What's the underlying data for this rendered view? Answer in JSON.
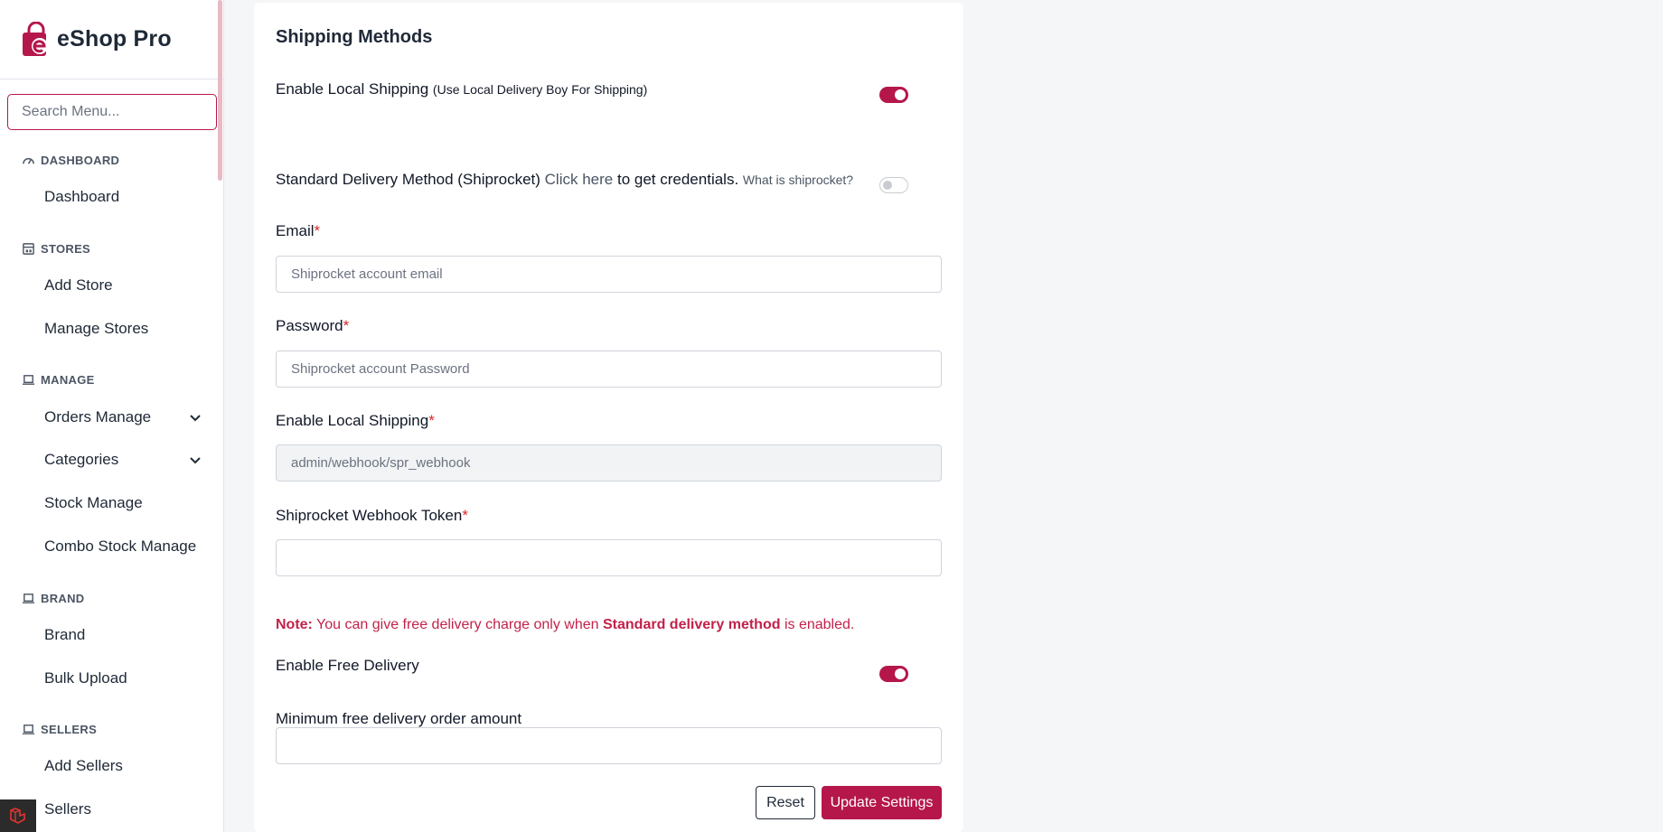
{
  "sidebar": {
    "logo_text": "eShop Pro",
    "search_placeholder": "Search Menu...",
    "sections": {
      "dashboard": {
        "title": "DASHBOARD",
        "items": [
          "Dashboard"
        ]
      },
      "stores": {
        "title": "STORES",
        "items": [
          "Add Store",
          "Manage Stores"
        ]
      },
      "manage": {
        "title": "MANAGE",
        "items": [
          "Orders Manage",
          "Categories",
          "Stock Manage",
          "Combo Stock Manage"
        ]
      },
      "brand": {
        "title": "BRAND",
        "items": [
          "Brand",
          "Bulk Upload"
        ]
      },
      "sellers": {
        "title": "SELLERS",
        "items": [
          "Add Sellers",
          "Sellers"
        ]
      }
    }
  },
  "main": {
    "title": "Shipping Methods",
    "local_shipping": {
      "label": "Enable Local Shipping",
      "hint": "(Use Local Delivery Boy For Shipping)",
      "enabled": true
    },
    "standard_delivery": {
      "label": "Standard Delivery Method (Shiprocket)",
      "link": "Click here",
      "after_link": "to get credentials.",
      "hint": "What is shiprocket?",
      "enabled": false
    },
    "email": {
      "label": "Email",
      "required_mark": "*",
      "placeholder": "Shiprocket account email"
    },
    "password": {
      "label": "Password",
      "required_mark": "*",
      "placeholder": "Shiprocket account Password"
    },
    "webhook_url": {
      "label": "Enable Local Shipping",
      "required_mark": "*",
      "value": "admin/webhook/spr_webhook"
    },
    "webhook_token": {
      "label": "Shiprocket Webhook Token",
      "required_mark": "*",
      "value": ""
    },
    "note": {
      "prefix": "Note:",
      "text1": "You can give free delivery charge only when",
      "highlight": "Standard delivery method",
      "text2": "is enabled."
    },
    "free_delivery": {
      "label": "Enable Free Delivery",
      "enabled": true
    },
    "min_amount": {
      "label": "Minimum free delivery order amount",
      "value": ""
    },
    "buttons": {
      "reset": "Reset",
      "update": "Update Settings"
    }
  },
  "colors": {
    "brand": "#b5174b",
    "note": "#c2224a"
  }
}
